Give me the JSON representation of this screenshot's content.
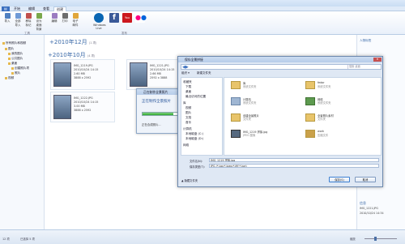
{
  "ribbon": {
    "tabs": [
      "开始",
      "编辑",
      "查看",
      "创建"
    ],
    "buttons": [
      {
        "label": "导入",
        "color": "#4f7fc0"
      },
      {
        "label": "全部导入",
        "color": "#6f9ad6"
      },
      {
        "label": "移除标记",
        "color": "#c0504d"
      },
      {
        "label": "设为桌面背景",
        "color": "#7aa84b"
      },
      {
        "label": "编辑",
        "color": "#9b7cc1"
      },
      {
        "label": "打印",
        "color": "#6d6d6d"
      },
      {
        "label": "电子邮件",
        "color": "#e0a63b"
      },
      {
        "label": "Windows Live",
        "color": "#0a66b3"
      },
      {
        "label": "Facebook",
        "color": "#3b5998"
      },
      {
        "label": "YouTube",
        "color": "#cc181e"
      },
      {
        "label": "Flickr",
        "color": "#ff0084"
      }
    ],
    "group_labels": [
      "工具",
      "发布"
    ]
  },
  "nav": {
    "items": [
      "所有照片和视频",
      "图片",
      "我的图片",
      "公共图片",
      "桌面",
      "创建照片项",
      "照片",
      "视频"
    ]
  },
  "main": {
    "year1": "2010年12月",
    "year1_count": "(1 项)",
    "year2": "2010年10月",
    "year2_count": "(4 项)",
    "tiles": [
      {
        "name": "IMG_1219.JPG",
        "date": "2010/10/24 14:15",
        "size": "2.60 MB",
        "dims": "3888 x 2592"
      },
      {
        "name": "IMG_1221.JPG",
        "date": "2010/10/24 14:15",
        "size": "2.66 MB",
        "dims": "2592 x 3888"
      },
      {
        "name": "IMG_1222.JPG",
        "date": "2010/10/24 14:15",
        "size": "3.00 MB",
        "dims": "3888 x 2592"
      }
    ]
  },
  "progress": {
    "title": "正在制作全景照片",
    "heading": "正在制作全景照片",
    "status": "正在合成照片..."
  },
  "save": {
    "title": "保存全景拼接",
    "search_placeholder": "搜索 桌面",
    "toolbar_left": "组织 ▾",
    "toolbar_new": "新建文件夹",
    "tree": [
      "收藏夹",
      "下载",
      "桌面",
      "最近访问的位置",
      "库",
      "视频",
      "图片",
      "文档",
      "音乐",
      "计算机",
      "本地磁盘 (C:)",
      "本地磁盘 (D:)",
      "网络"
    ],
    "files": [
      {
        "name": "库",
        "desc": "系统文件夹"
      },
      {
        "name": "fedor",
        "desc": "系统文件夹"
      },
      {
        "name": "计算机",
        "desc": "系统文件夹"
      },
      {
        "name": "网络",
        "desc": "系统文件夹"
      },
      {
        "name": "创建全景照片",
        "desc": "文件夹"
      },
      {
        "name": "全景照片素材",
        "desc": "文件夹"
      },
      {
        "name": "IMG_1219 拼接.jpg",
        "desc": "JPEG 图像"
      },
      {
        "name": "work",
        "desc": "压缩文件"
      }
    ],
    "filename_label": "文件名(N):",
    "filename_value": "IMG_1219 拼接.jpg",
    "type_label": "保存类型(T):",
    "type_value": "JPG (*.jpg;*.jpeg;*.jfif;*.jpe)",
    "hide_folders": "隐藏文件夹",
    "save_button": "保存(S)",
    "cancel_button": "取消"
  },
  "right_pane": {
    "label": "人物标签",
    "info_title": "信息",
    "info_name": "IMG_1221.JPG",
    "info_date": "2010/10/24 14:34"
  },
  "status": {
    "items": "12 项",
    "selected": "已选择 5 项",
    "zoom": "缩放"
  }
}
